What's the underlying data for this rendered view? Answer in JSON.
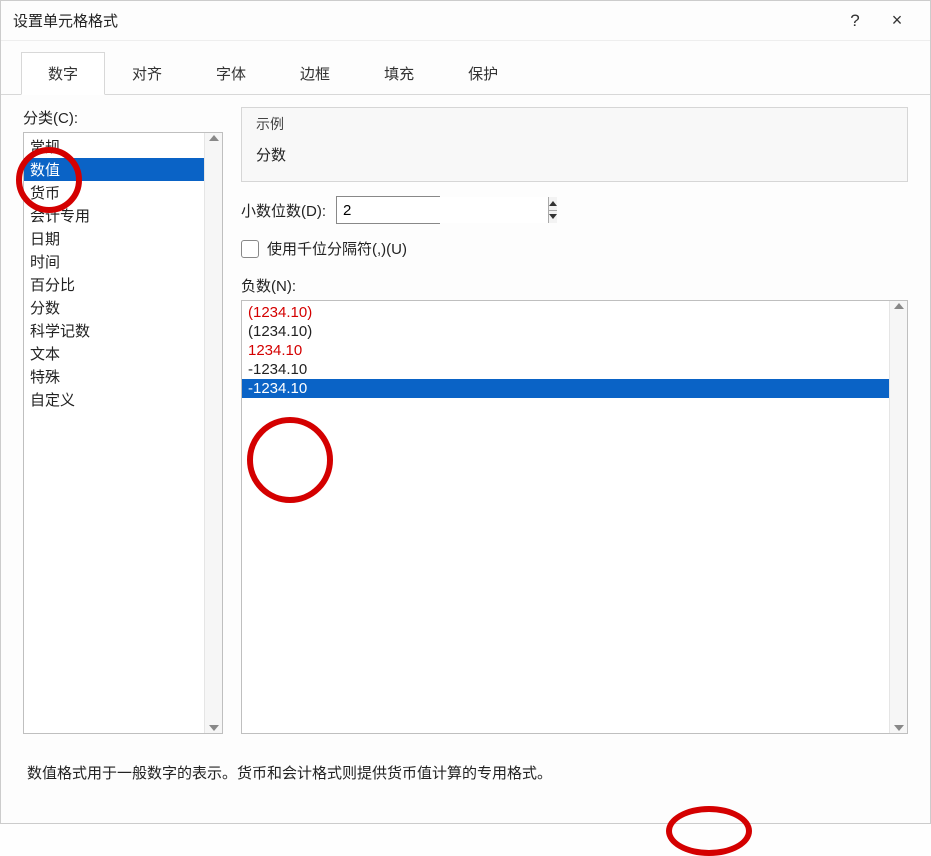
{
  "title": "设置单元格格式",
  "titlebar": {
    "help": "?",
    "close": "×"
  },
  "tabs": [
    "数字",
    "对齐",
    "字体",
    "边框",
    "填充",
    "保护"
  ],
  "activeTab": 0,
  "categoryLabel": "分类(C):",
  "categories": [
    "常规",
    "数值",
    "货币",
    "会计专用",
    "日期",
    "时间",
    "百分比",
    "分数",
    "科学记数",
    "文本",
    "特殊",
    "自定义"
  ],
  "selectedCategory": 1,
  "sample": {
    "label": "示例",
    "value": "分数"
  },
  "decimal": {
    "label": "小数位数(D):",
    "value": "2"
  },
  "thousands": {
    "label": "使用千位分隔符(,)(U)",
    "checked": false
  },
  "negativeLabel": "负数(N):",
  "negativeFormats": [
    {
      "text": "(1234.10)",
      "color": "red"
    },
    {
      "text": "(1234.10)",
      "color": "black"
    },
    {
      "text": "1234.10",
      "color": "red"
    },
    {
      "text": "-1234.10",
      "color": "black"
    },
    {
      "text": "-1234.10",
      "color": "red"
    }
  ],
  "selectedNegative": 4,
  "description": "数值格式用于一般数字的表示。货币和会计格式则提供货币值计算的专用格式。"
}
